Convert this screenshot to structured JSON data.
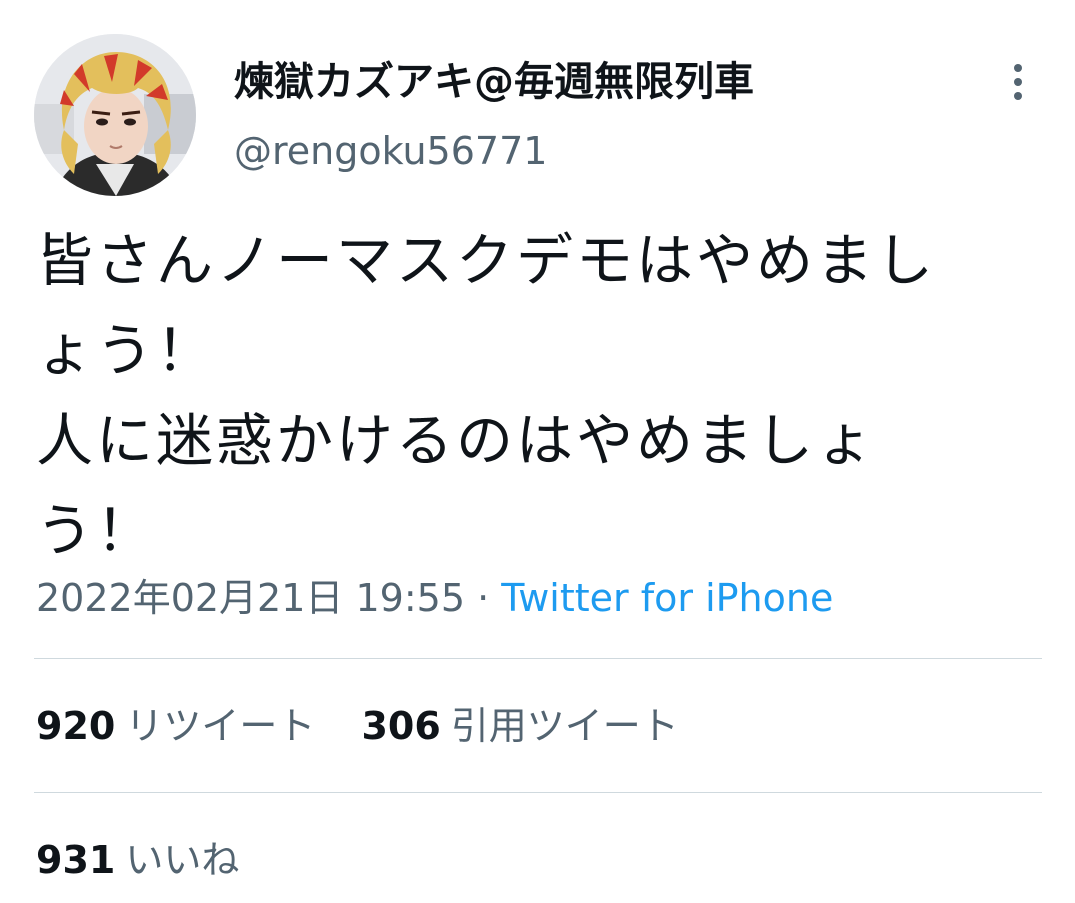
{
  "tweet": {
    "author": {
      "display_name": "煉獄カズアキ@毎週無限列車",
      "handle": "@rengoku56771"
    },
    "text_lines": [
      "皆さんノーマスクデモはやめまし",
      "ょう！",
      "人に迷惑かけるのはやめましょ",
      "う！"
    ],
    "timestamp": "2022年02月21日 19:55",
    "separator": "·",
    "source": "Twitter for iPhone",
    "stats": {
      "retweets": {
        "count": "920",
        "label": "リツイート"
      },
      "quotes": {
        "count": "306",
        "label": "引用ツイート"
      },
      "likes": {
        "count": "931",
        "label": "いいね"
      }
    }
  },
  "icons": {
    "more": "more-vertical-icon",
    "avatar": "profile-avatar"
  }
}
